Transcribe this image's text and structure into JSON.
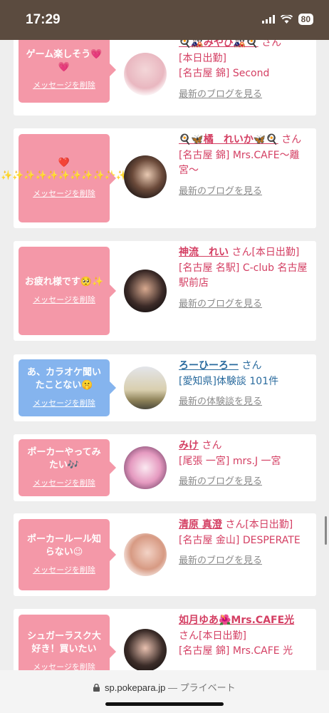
{
  "status": {
    "time": "17:29",
    "battery": "80"
  },
  "items": [
    {
      "message": "ゲーム楽しそう💗💗",
      "delete": "メッセージを削除",
      "bubble": "pink",
      "name": "🍳🎎みやび🎎🍳",
      "san": "さん",
      "line1": "[本日出勤]",
      "shop": "[名古屋 錦] Second",
      "link": "最新のブログを見る"
    },
    {
      "message": "❤️✨✨✨✨✨✨✨✨✨✨✨",
      "delete": "メッセージを削除",
      "bubble": "pink",
      "name": "🍳🦋橘　れいか🦋🍳",
      "san": "さん",
      "line1": "",
      "shop": "[名古屋 錦] Mrs.CAFE〜離宮〜",
      "link": "最新のブログを見る"
    },
    {
      "message": "お疲れ様です🥺✨",
      "delete": "メッセージを削除",
      "bubble": "pink",
      "name": "神流　れい",
      "san": "さん[本日出勤]",
      "line1": "",
      "shop": "[名古屋 名駅] C-club 名古屋駅前店",
      "link": "最新のブログを見る"
    },
    {
      "message": "あ、カラオケ聞いたことない🤫",
      "delete": "メッセージを削除",
      "bubble": "blue",
      "name": "ろーひーろー",
      "san": "さん",
      "line1": "",
      "shop": "[愛知県]体験談 101件",
      "link": "最新の体験談を見る"
    },
    {
      "message": "ポーカーやってみたい🎶",
      "delete": "メッセージを削除",
      "bubble": "pink",
      "name": "みけ",
      "san": "さん",
      "line1": "",
      "shop": "[尾張 一宮] mrs.J 一宮",
      "link": "最新のブログを見る"
    },
    {
      "message": "ポーカールール知らない😉",
      "delete": "メッセージを削除",
      "bubble": "pink",
      "name": "清原 真澄",
      "san": "さん[本日出勤]",
      "line1": "",
      "shop": "[名古屋 金山] DESPERATE",
      "link": "最新のブログを見る"
    },
    {
      "message": "シュガーラスク大好き！買いたい",
      "delete": "メッセージを削除",
      "bubble": "pink",
      "name": "如月ゆあ🌺Mrs.CAFE光",
      "san": "さん[本日出勤]",
      "line1": "",
      "shop": "[名古屋 錦] Mrs.CAFE 光",
      "link": ""
    }
  ],
  "urlbar": {
    "domain": "sp.pokepara.jp",
    "privacy": "— プライベート"
  },
  "colors": {
    "pink": "#f498a8",
    "blue": "#85b4ee",
    "name_pink": "#d43f63",
    "name_blue": "#2a6b9e"
  }
}
